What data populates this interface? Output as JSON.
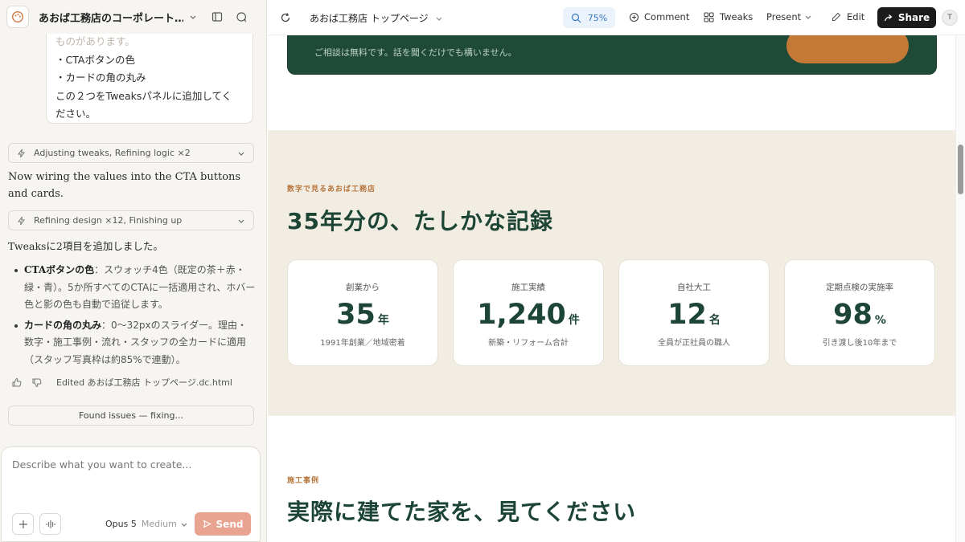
{
  "sidebar": {
    "project_title": "あおば工務店のコーポレート…",
    "bubble": {
      "lines": [
        "ものがあります。",
        "・CTAボタンの色",
        "・カードの角の丸み",
        "この２つをTweaksパネルに追加してく",
        "ださい。"
      ]
    },
    "tool1": "Adjusting tweaks, Refining logic ×2",
    "msg1": "Now wiring the values into the CTA buttons and cards.",
    "tool2": "Refining design ×12, Finishing up",
    "msg2": "Tweaksに2項目を追加しました。",
    "bullets": [
      {
        "title": "CTAボタンの色",
        "text": "：スウォッチ4色（既定の茶＋赤・緑・青）。5か所すべてのCTAに一括適用され、ホバー色と影の色も自動で追従します。"
      },
      {
        "title": "カードの角の丸み",
        "text": "：0〜32pxのスライダー。理由・数字・施工事例・流れ・スタッフの全カードに適用（スタッフ写真枠は約85%で連動）。"
      }
    ],
    "edited": "Edited あおば工務店 トップページ.dc.html",
    "found": "Found issues — fixing...",
    "composer": {
      "placeholder": "Describe what you want to create...",
      "model": "Opus 5",
      "effort": "Medium",
      "send": "Send"
    }
  },
  "topbar": {
    "title": "あおば工務店 トップページ",
    "zoom": "75%",
    "comment": "Comment",
    "tweaks": "Tweaks",
    "present": "Present",
    "edit": "Edit",
    "share": "Share",
    "avatar": "T"
  },
  "preview": {
    "cta_text": "ご相談は無料です。話を聞くだけでも構いません。",
    "stats": {
      "eyebrow": "数字で見るあおば工務店",
      "heading": "35年分の、たしかな記録",
      "cards": [
        {
          "label": "創業から",
          "value": "35",
          "unit": "年",
          "note": "1991年創業／地域密着"
        },
        {
          "label": "施工実績",
          "value": "1,240",
          "unit": "件",
          "note": "新築・リフォーム合計"
        },
        {
          "label": "自社大工",
          "value": "12",
          "unit": "名",
          "note": "全員が正社員の職人"
        },
        {
          "label": "定期点検の実施率",
          "value": "98",
          "unit": "%",
          "note": "引き渡し後10年まで"
        }
      ]
    },
    "works": {
      "eyebrow": "施工事例",
      "heading": "実際に建てた家を、見てください"
    }
  },
  "colors": {
    "brand_green": "#1d4535",
    "accent_brown": "#b7753c",
    "send": "#e9a491"
  }
}
